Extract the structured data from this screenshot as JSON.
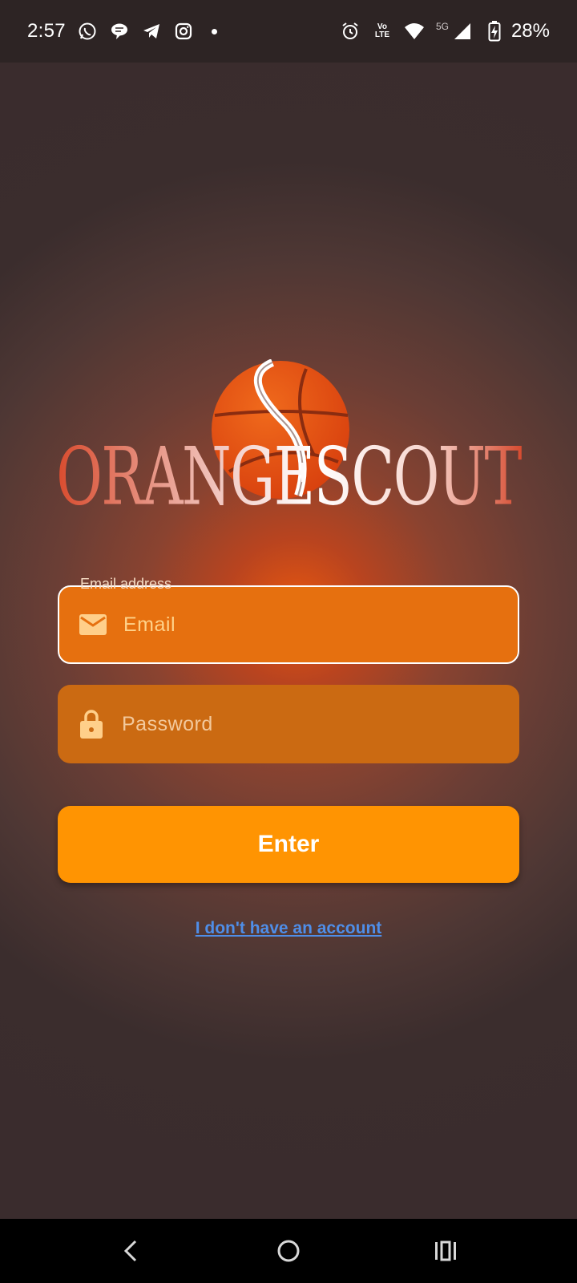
{
  "status_bar": {
    "time": "2:57",
    "network": "5G",
    "volte_top": "Vo",
    "volte_bottom": "LTE",
    "battery": "28%",
    "left_icons": [
      "whatsapp-icon",
      "chat-bubble-icon",
      "telegram-icon",
      "instagram-icon",
      "dot-icon"
    ],
    "right_icons": [
      "alarm-icon",
      "volte-icon",
      "wifi-icon",
      "signal-icon",
      "battery-charging-icon"
    ]
  },
  "logo": {
    "text": "ORANGESCOUT",
    "icon": "basketball-icon"
  },
  "form": {
    "email": {
      "label": "Email address",
      "placeholder": "Email",
      "icon": "mail-icon"
    },
    "password": {
      "placeholder": "Password",
      "icon": "lock-icon"
    },
    "submit_label": "Enter",
    "signup_link": "I don't have an account"
  },
  "nav_bar": {
    "items": [
      "back-icon",
      "home-icon",
      "recents-icon"
    ]
  },
  "colors": {
    "background": "#3a2c2c",
    "accent": "#ff9402",
    "email_field": "#e6700f",
    "password_field": "#cb6a12",
    "link": "#4f8ee8"
  }
}
